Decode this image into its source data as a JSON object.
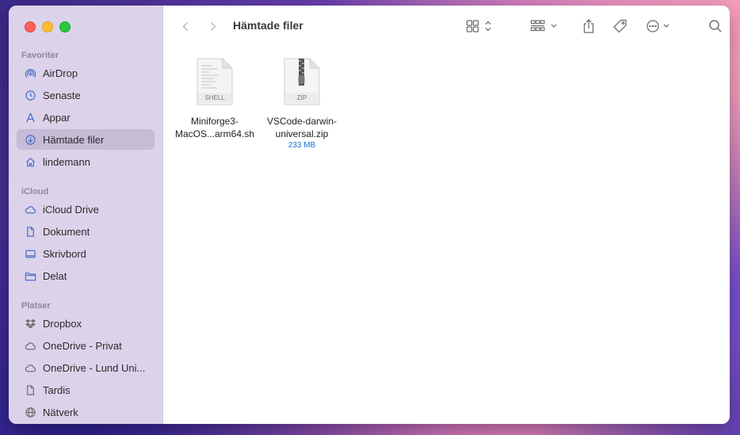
{
  "window": {
    "title": "Hämtade filer"
  },
  "sidebar": {
    "sections": [
      {
        "label": "Favoriter"
      },
      {
        "label": "iCloud"
      },
      {
        "label": "Platser"
      }
    ],
    "items": [
      {
        "label": "AirDrop",
        "icon": "airdrop-icon"
      },
      {
        "label": "Senaste",
        "icon": "clock-icon"
      },
      {
        "label": "Appar",
        "icon": "apps-icon"
      },
      {
        "label": "Hämtade filer",
        "icon": "download-icon",
        "selected": true
      },
      {
        "label": "lindemann",
        "icon": "home-icon"
      },
      {
        "label": "iCloud Drive",
        "icon": "cloud-icon"
      },
      {
        "label": "Dokument",
        "icon": "document-icon"
      },
      {
        "label": "Skrivbord",
        "icon": "desktop-icon"
      },
      {
        "label": "Delat",
        "icon": "shared-folder-icon"
      },
      {
        "label": "Dropbox",
        "icon": "dropbox-icon"
      },
      {
        "label": "OneDrive - Privat",
        "icon": "cloud-icon"
      },
      {
        "label": "OneDrive - Lund Uni...",
        "icon": "cloud-icon"
      },
      {
        "label": "Tardis",
        "icon": "document-icon"
      },
      {
        "label": "Nätverk",
        "icon": "globe-icon"
      }
    ]
  },
  "files": [
    {
      "name_line1": "Miniforge3-",
      "name_line2": "MacOS...arm64.sh",
      "badge": "SHELL",
      "size": ""
    },
    {
      "name_line1": "VSCode-darwin-",
      "name_line2": "universal.zip",
      "badge": "ZIP",
      "size": "233 MB"
    }
  ],
  "colors": {
    "accent": "#1a6fd6",
    "sidebar_bg": "#dcd3ea",
    "selected_bg": "#c5bcd6"
  }
}
